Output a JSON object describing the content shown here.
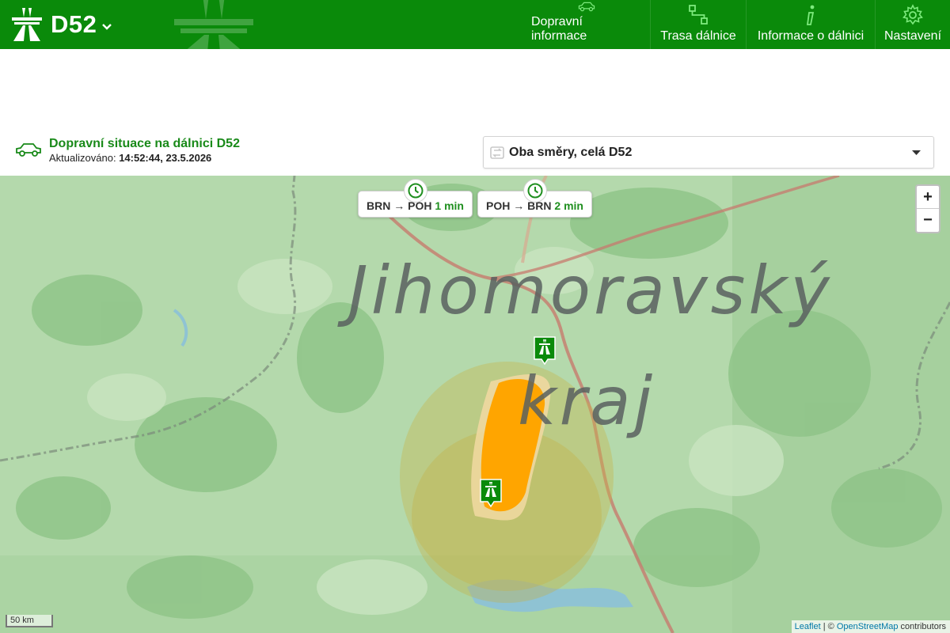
{
  "header": {
    "title": "D52",
    "nav": [
      {
        "label": "Dopravní informace",
        "icon": "car-icon"
      },
      {
        "label": "Trasa dálnice",
        "icon": "route-icon"
      },
      {
        "label": "Informace o dálnici",
        "icon": "info-icon"
      },
      {
        "label": "Nastavení",
        "icon": "gear-icon"
      }
    ]
  },
  "status": {
    "title": "Dopravní situace na dálnici D52",
    "updated_label": "Aktualizováno:",
    "updated_value": "14:52:44, 23.5.2026"
  },
  "direction": {
    "selected": "Oba směry, celá D52"
  },
  "map": {
    "region_label_1": "Jihomoravský",
    "region_label_2": "kraj",
    "travel_times": [
      {
        "from": "BRN",
        "arrow": "→",
        "to": "POH",
        "duration": "1 min"
      },
      {
        "from": "POH",
        "arrow": "→",
        "to": "BRN",
        "duration": "2 min"
      }
    ],
    "zoom_in": "+",
    "zoom_out": "−",
    "scale_label": "50 km",
    "attribution": {
      "leaflet": "Leaflet",
      "separator": " | © ",
      "osm": "OpenStreetMap",
      "suffix": " contributors"
    }
  },
  "colors": {
    "header_green": "#0a8a0a",
    "accent_green": "#198a19",
    "congestion_orange": "#ffa500",
    "map_green": "#a9d3a1"
  }
}
